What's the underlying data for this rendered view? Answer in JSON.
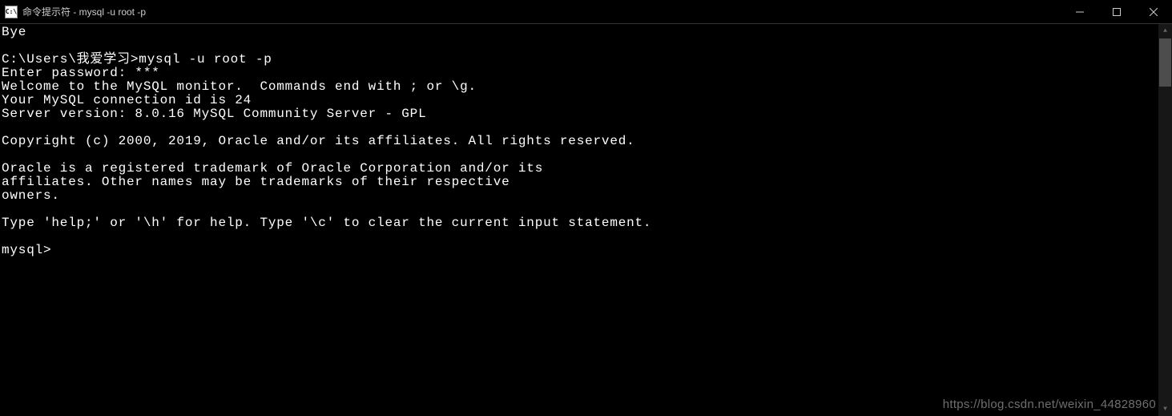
{
  "window": {
    "title": "命令提示符 - mysql  -u root -p"
  },
  "terminal": {
    "lines": [
      "Bye",
      "",
      "C:\\Users\\我爱学习>mysql -u root -p",
      "Enter password: ***",
      "Welcome to the MySQL monitor.  Commands end with ; or \\g.",
      "Your MySQL connection id is 24",
      "Server version: 8.0.16 MySQL Community Server - GPL",
      "",
      "Copyright (c) 2000, 2019, Oracle and/or its affiliates. All rights reserved.",
      "",
      "Oracle is a registered trademark of Oracle Corporation and/or its",
      "affiliates. Other names may be trademarks of their respective",
      "owners.",
      "",
      "Type 'help;' or '\\h' for help. Type '\\c' to clear the current input statement.",
      "",
      "mysql>"
    ]
  },
  "watermark": "https://blog.csdn.net/weixin_44828960"
}
